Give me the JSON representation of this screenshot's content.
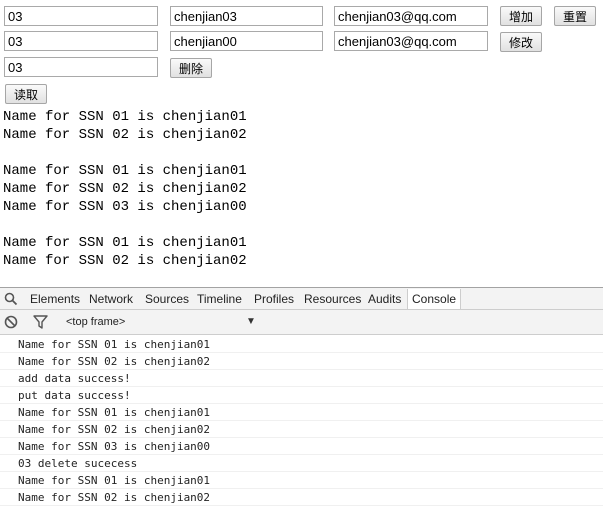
{
  "form": {
    "row1": {
      "ssn": "03",
      "name": "chenjian03",
      "email": "chenjian03@qq.com",
      "add_label": "增加",
      "reset_label": "重置"
    },
    "row2": {
      "ssn": "03",
      "name": "chenjian00",
      "email": "chenjian03@qq.com",
      "modify_label": "修改"
    },
    "row3": {
      "ssn": "03",
      "delete_label": "删除"
    },
    "read_label": "读取"
  },
  "output": [
    "Name for SSN 01 is chenjian01",
    "Name for SSN 02 is chenjian02",
    "",
    "Name for SSN 01 is chenjian01",
    "Name for SSN 02 is chenjian02",
    "Name for SSN 03 is chenjian00",
    "",
    "Name for SSN 01 is chenjian01",
    "Name for SSN 02 is chenjian02"
  ],
  "devtools": {
    "tabs": [
      "Elements",
      "Network",
      "Sources",
      "Timeline",
      "Profiles",
      "Resources",
      "Audits",
      "Console"
    ],
    "active_tab": "Console",
    "frame_selector": "<top frame>",
    "console_lines": [
      "Name for SSN 01 is chenjian01",
      "Name for SSN 02 is chenjian02",
      "add data success!",
      "put data success!",
      "Name for SSN 01 is chenjian01",
      "Name for SSN 02 is chenjian02",
      "Name for SSN 03 is chenjian00",
      "03 delete sucecess",
      "Name for SSN 01 is chenjian01",
      "Name for SSN 02 is chenjian02"
    ]
  },
  "icons": {
    "search": "search-icon",
    "clear": "clear-console-icon",
    "filter": "filter-icon",
    "dropdown": "chevron-down-icon"
  }
}
